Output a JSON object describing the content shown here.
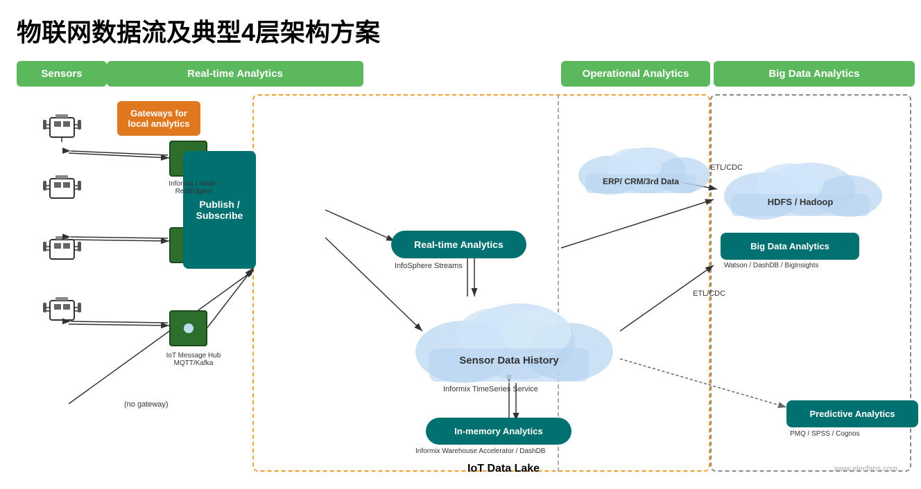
{
  "title": "物联网数据流及典型4层架构方案",
  "columns": {
    "sensors": "Sensors",
    "realtime": "Real-time Analytics",
    "operational": "Operational Analytics",
    "bigdata": "Big Data Analytics"
  },
  "gateway": {
    "label": "Gateways for local analytics"
  },
  "pubsub": {
    "label": "Publish / Subscribe"
  },
  "devices": [
    {
      "label": "Informix / Node-Red/Edgent"
    },
    {
      "label": ""
    },
    {
      "label": "IoT Message Hub MQTT/Kafka"
    }
  ],
  "noGateway": "(no gateway)",
  "rtAnalyticsInner": "Real-time Analytics",
  "rtSubLabel": "InfoSphere Streams",
  "inMemory": "In-memory Analytics",
  "inMemorySubLabel": "Informix Warehouse Accelerator / DashDB",
  "sensorDataHistory": "Sensor Data History",
  "informixTimeSeries": "Informix TimeSeries Service",
  "bigDataAnalytics": "Big Data Analytics",
  "bigDataSubLabel": "Watson / DashDB / BigInsights",
  "hdfsLabel": "HDFS / Hadoop",
  "erpLabel": "ERP/ CRM/3rd Data",
  "etlCdc1": "ETL/CDC",
  "etlCdc2": "ETL/CDC",
  "predictiveAnalytics": "Predictive Analytics",
  "predictiveSubLabel": "PMQ / SPSS / Cognos",
  "iotDataLake": "IoT  Data Lake",
  "watermark": "www.elecfans.com"
}
